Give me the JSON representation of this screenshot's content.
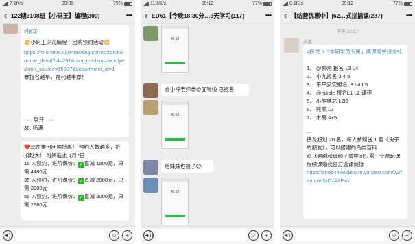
{
  "screens": [
    {
      "status": {
        "carrier": "ıl",
        "speed": "7.1K/s",
        "time": "09:08",
        "battery": "79%"
      },
      "title": "122期3108班【小码王】编程(309)",
      "messages": {
        "m1": {
          "tag": "#接龙",
          "lines": [
            "💥小码王少儿编程一团购预约活动💥"
          ],
          "url": "https://m-online.xiaomawang.com/scratch/course_detail?id=291&utm_medium=luodlye&utm_source=15087&department_id=1",
          "after": "😎报名越早，福利越丰厚！",
          "expand": "· · · 展开 · · ·",
          "item": "36. 杨满"
        },
        "m2": {
          "intro": "❤️现在推出团购特惠！ 预约人数越多，折扣越大！ 时间截止 1月7日",
          "tiers": [
            {
              "line1": "15 人预约，进阶课价：",
              "check": "✓",
              "line2": "直减 1500元，只需 4480元"
            },
            {
              "line1": "35 人预约，进阶课价：",
              "check": "✓",
              "line2": "直减 2000元，只需 3980元"
            },
            {
              "line1": "55 人预约，进阶课价：",
              "check": "✓",
              "line2": "直减 3000元，只需 2980元"
            }
          ]
        }
      }
    },
    {
      "status": {
        "carrier": "ıl",
        "speed": "11.6K/s",
        "time": "09:12",
        "battery": "77%"
      },
      "title": "ED61【今晚18:30分…3天学习(117)",
      "messages": {
        "s1_amount": "¥0.16",
        "s2_amount": "¥0.16",
        "s3_amount": "¥0.16",
        "t1": "@小梓老师😎@面啾啦 已报名",
        "t2": "给妹妹也报了😊"
      }
    },
    {
      "status": {
        "carrier": "ıl",
        "speed": "0.1K/s",
        "time": "09:12",
        "battery": "77%"
      },
      "title": "【结营优惠中】|62…式拼插课(287)",
      "time_label": "昨天 22:17",
      "sender": "夫巢",
      "messages": {
        "tags": "#接龙 #「本期学员专属」续课赠单接龙礼",
        "list": [
          "1、 @柳燕  报名 L3 L4",
          "2、 小九报名 3 4 5",
          "3、 平平安安报名L3 L4 L5",
          "4、 @nicole 报名L1 L2 课程",
          "5、 小熊维尼 L2l3",
          "6、 熊熊 L3",
          "7、 木易 4+5"
        ],
        "dots": "…",
        "footer": "接龙超过 20 名，每人参赠送 1 套《兔子的朋友》，可以搭建的鸟类百科",
        "footer2": "鸡飞狗跳和母颜子豪中间只需一个摩玩课程续课赠我官方选课链接",
        "url": "https://shop44892856.m.youzan.com/v2/feature/0rOz4XFkiv"
      }
    }
  ],
  "bottom": {
    "voice": "◄))",
    "emoji": "☺",
    "plus": "+"
  }
}
